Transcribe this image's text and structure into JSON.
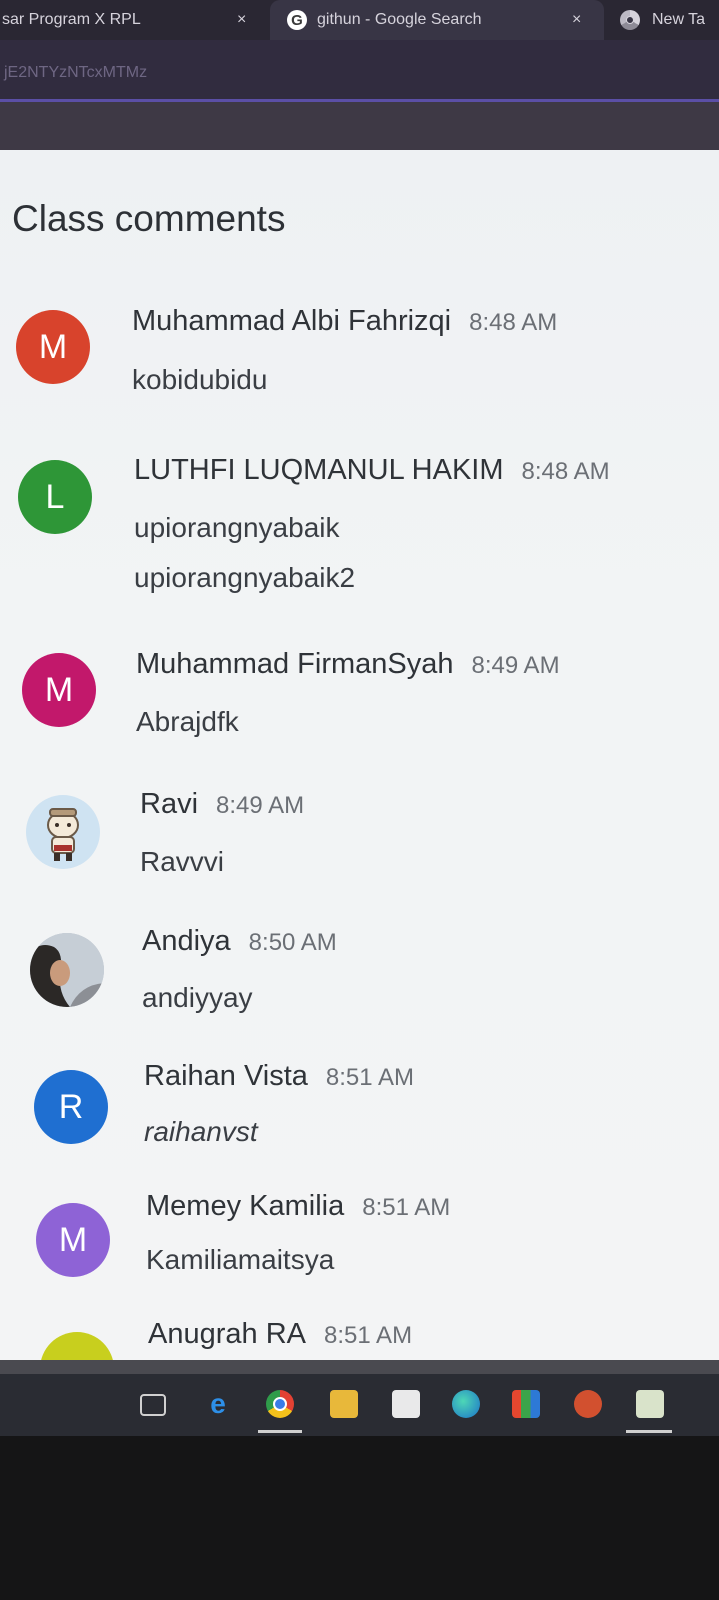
{
  "browser": {
    "tabs": [
      {
        "title": "sar Program X RPL",
        "close": "×"
      },
      {
        "title": "githun - Google Search",
        "close": "×",
        "icon": "google-icon"
      },
      {
        "title": "New Ta",
        "icon": "chrome-icon"
      }
    ],
    "url": "jE2NTYzNTcxMTMz"
  },
  "page": {
    "title": "Class comments"
  },
  "comments": [
    {
      "avatar_letter": "M",
      "avatar_color": "#d8432c",
      "author": "Muhammad Albi Fahrizqi",
      "time": "8:48 AM",
      "lines": [
        "kobidubidu"
      ]
    },
    {
      "avatar_letter": "L",
      "avatar_color": "#2e9637",
      "author": "LUTHFI LUQMANUL HAKIM",
      "time": "8:48 AM",
      "lines": [
        "upiorangnyabaik",
        "upiorangnyabaik2"
      ]
    },
    {
      "avatar_letter": "M",
      "avatar_color": "#c2186b",
      "author": "Muhammad FirmanSyah",
      "time": "8:49 AM",
      "lines": [
        "Abrajdfk"
      ]
    },
    {
      "avatar_letter": "",
      "avatar_color": "#cfe3f2",
      "avatar_icon": "cartoon-avatar",
      "author": "Ravi",
      "time": "8:49 AM",
      "lines": [
        "Ravvvi"
      ]
    },
    {
      "avatar_letter": "",
      "avatar_color": "#6f7781",
      "avatar_icon": "photo-avatar",
      "author": "Andiya",
      "time": "8:50 AM",
      "lines": [
        "andiyyay"
      ]
    },
    {
      "avatar_letter": "R",
      "avatar_color": "#1f6fd1",
      "author": "Raihan Vista",
      "time": "8:51 AM",
      "lines": [
        "raihanvst"
      ]
    },
    {
      "avatar_letter": "M",
      "avatar_color": "#8e63d6",
      "author": "Memey Kamilia",
      "time": "8:51 AM",
      "lines": [
        "Kamiliamaitsya"
      ]
    },
    {
      "avatar_letter": "",
      "avatar_color": "#c8cf1e",
      "author": "Anugrah RA",
      "time": "8:51 AM",
      "lines": []
    }
  ],
  "taskbar": {
    "icons": [
      "task-view-icon",
      "edge-legacy-icon",
      "chrome-icon",
      "file-explorer-icon",
      "store-icon",
      "edge-icon",
      "app-grid-icon",
      "powerpoint-icon",
      "folder-icon"
    ]
  }
}
